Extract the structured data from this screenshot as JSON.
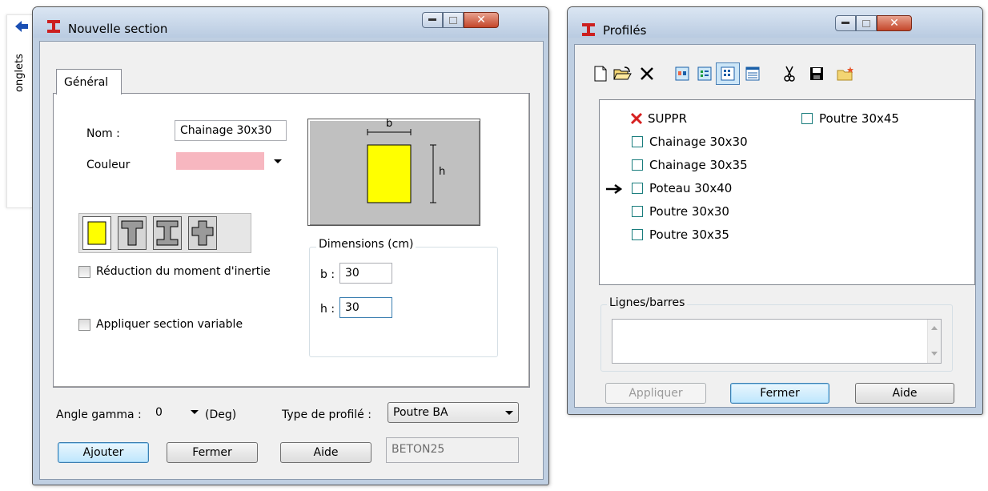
{
  "side_panel": {
    "label": "onglets"
  },
  "nouvelle_section": {
    "title": "Nouvelle section",
    "tab": "Général",
    "nom_label": "Nom :",
    "nom_value": "Chainage 30x30",
    "couleur_label": "Couleur",
    "couleur_value": "#f7b7c0",
    "diagram": {
      "b": "b",
      "h": "h"
    },
    "reduction_label": "Réduction du moment d'inertie",
    "variable_label": "Appliquer section variable",
    "dimensions": {
      "title": "Dimensions (cm)",
      "b_label": "b :",
      "b_value": "30",
      "h_label": "h :",
      "h_value": "30"
    },
    "angle_label": "Angle gamma :",
    "angle_value": "0",
    "angle_unit": "(Deg)",
    "type_label": "Type de profilé :",
    "type_value": "Poutre BA",
    "buttons": {
      "ajouter": "Ajouter",
      "fermer": "Fermer",
      "aide": "Aide"
    },
    "material": "BETON25"
  },
  "profiles": {
    "title": "Profilés",
    "items_col1": [
      "SUPPR",
      "Chainage 30x30",
      "Chainage 30x35",
      "Poteau 30x40",
      "Poutre 30x30",
      "Poutre 30x35"
    ],
    "items_col2": [
      "Poutre 30x45"
    ],
    "lignes_title": "Lignes/barres",
    "buttons": {
      "appliquer": "Appliquer",
      "fermer": "Fermer",
      "aide": "Aide"
    }
  },
  "colors": {
    "accent": "#1a7d7d",
    "yellow": "#ffff00",
    "title_icon": "#cc1f1f"
  }
}
